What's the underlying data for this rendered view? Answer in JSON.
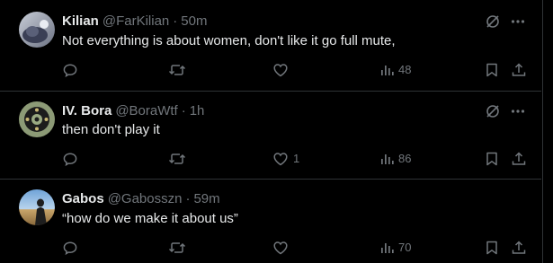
{
  "tweets": [
    {
      "display_name": "Kilian",
      "handle": "@FarKilian",
      "separator": "·",
      "time": "50m",
      "text": "Not everything is about women, don't like it go full mute,",
      "avatar_icon": "avatar-kilian",
      "likes": "",
      "views": "48"
    },
    {
      "display_name": "IV. Bora",
      "handle": "@BoraWtf",
      "separator": "·",
      "time": "1h",
      "text": "then don't play it",
      "avatar_icon": "avatar-bora",
      "likes": "1",
      "views": "86"
    },
    {
      "display_name": "Gabos",
      "handle": "@Gabosszn",
      "separator": "·",
      "time": "59m",
      "text": "“how do we make it about us”",
      "avatar_icon": "avatar-gabos",
      "likes": "",
      "views": "70"
    }
  ],
  "colors": {
    "background": "#000000",
    "text": "#e7e9ea",
    "muted": "#71767b",
    "divider": "#2f3336"
  },
  "icons": {
    "reply": "reply-icon",
    "repost": "repost-icon",
    "like": "like-icon",
    "views": "views-icon",
    "bookmark": "bookmark-icon",
    "share": "share-icon",
    "grok": "grok-icon",
    "more": "more-icon"
  }
}
